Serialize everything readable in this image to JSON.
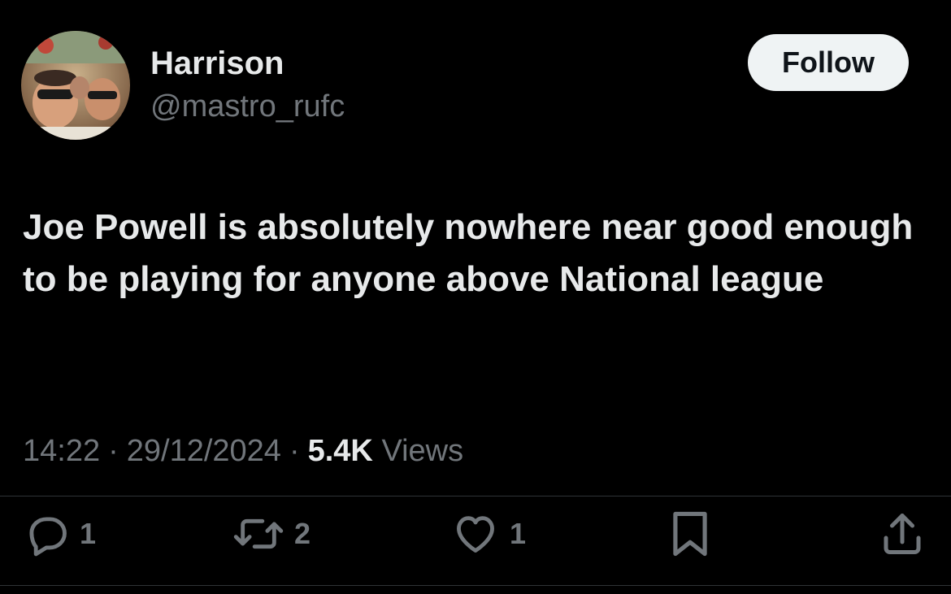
{
  "author": {
    "display_name": "Harrison",
    "handle": "@mastro_rufc"
  },
  "follow_label": "Follow",
  "tweet": {
    "text": "Joe Powell is absolutely nowhere near good enough to be playing for anyone above National league"
  },
  "meta": {
    "time": "14:22",
    "date": "29/12/2024",
    "views_count": "5.4K",
    "views_label": "Views",
    "separator": "·"
  },
  "actions": {
    "reply": {
      "icon": "reply-icon",
      "count": "1"
    },
    "repost": {
      "icon": "repost-icon",
      "count": "2"
    },
    "like": {
      "icon": "heart-icon",
      "count": "1"
    },
    "bookmark": {
      "icon": "bookmark-icon"
    },
    "share": {
      "icon": "share-icon"
    }
  },
  "colors": {
    "background": "#000000",
    "primary_text": "#e7e9ea",
    "secondary_text": "#71767b",
    "follow_button_bg": "#eff3f4",
    "follow_button_text": "#0f1419",
    "divider": "#2f3336"
  }
}
